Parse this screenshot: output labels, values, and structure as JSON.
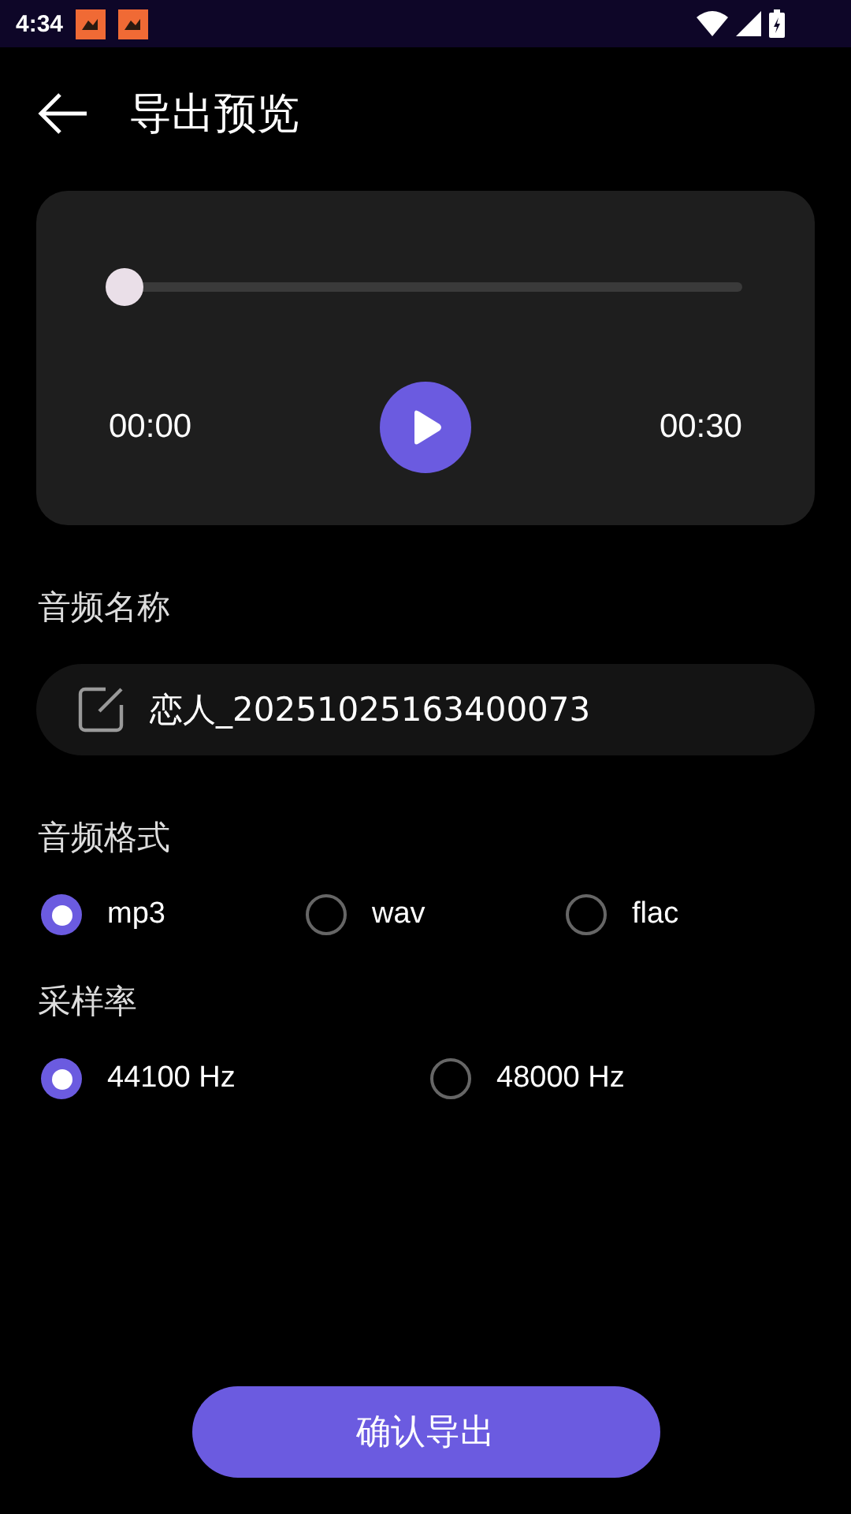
{
  "status_bar": {
    "time": "4:34",
    "notifications": [
      {
        "kind": "app"
      },
      {
        "kind": "app"
      }
    ]
  },
  "header": {
    "title": "导出预览"
  },
  "player": {
    "level": 0,
    "elapsed": "00:00",
    "duration": "00:30",
    "playing": false
  },
  "name_section": {
    "label": "音频名称",
    "value": "恋人_20251025163400073"
  },
  "format_section": {
    "label": "音频格式",
    "options": [
      {
        "label": "mp3",
        "selected": true
      },
      {
        "label": "wav",
        "selected": false
      },
      {
        "label": "flac",
        "selected": false
      }
    ]
  },
  "rate_section": {
    "label": "采样率",
    "options": [
      {
        "label": "44100 Hz",
        "selected": true
      },
      {
        "label": "48000 Hz",
        "selected": false
      }
    ]
  },
  "confirm_button": "确认导出"
}
